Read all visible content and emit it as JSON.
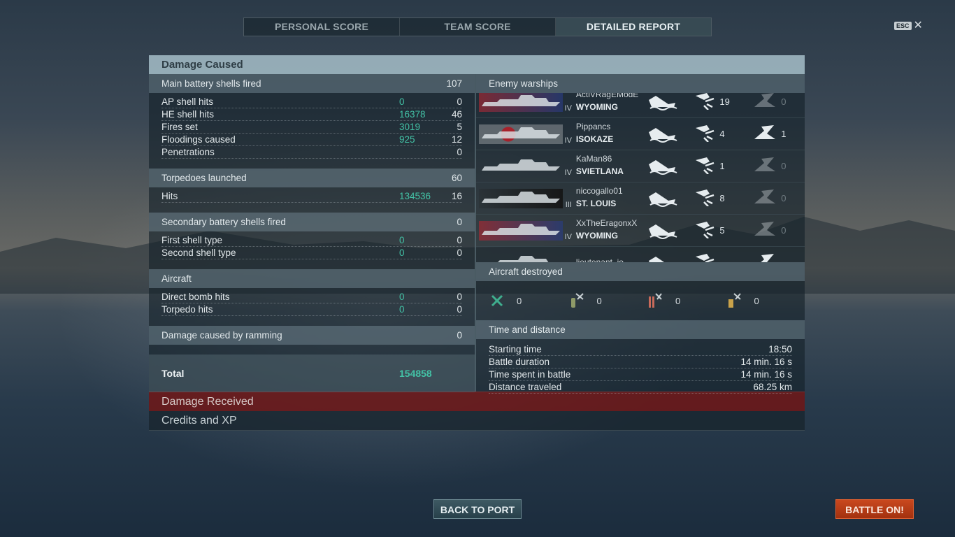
{
  "tabs": [
    "PERSONAL SCORE",
    "TEAM SCORE",
    "DETAILED REPORT"
  ],
  "esc_label": "ESC",
  "damage_caused": {
    "title": "Damage Caused",
    "main_battery": {
      "label": "Main battery shells fired",
      "count": "107",
      "rows": [
        {
          "label": "AP shell hits",
          "damage": "0",
          "count": "0"
        },
        {
          "label": "HE shell hits",
          "damage": "16378",
          "count": "46"
        },
        {
          "label": "Fires set",
          "damage": "3019",
          "count": "5"
        },
        {
          "label": "Floodings caused",
          "damage": "925",
          "count": "12"
        },
        {
          "label": "Penetrations",
          "damage": "",
          "count": "0"
        }
      ]
    },
    "torpedoes": {
      "label": "Torpedoes launched",
      "count": "60",
      "rows": [
        {
          "label": "Hits",
          "damage": "134536",
          "count": "16"
        }
      ]
    },
    "secondary": {
      "label": "Secondary battery shells fired",
      "count": "0",
      "rows": [
        {
          "label": "First shell type",
          "damage": "0",
          "count": "0"
        },
        {
          "label": "Second shell type",
          "damage": "0",
          "count": "0"
        }
      ]
    },
    "aircraft": {
      "label": "Aircraft",
      "rows": [
        {
          "label": "Direct bomb hits",
          "damage": "0",
          "count": "0"
        },
        {
          "label": "Torpedo hits",
          "damage": "0",
          "count": "0"
        }
      ]
    },
    "ramming": {
      "label": "Damage caused by ramming",
      "count": "0"
    },
    "total": {
      "label": "Total",
      "value": "154858"
    }
  },
  "enemy_warships": {
    "title": "Enemy warships",
    "ships": [
      {
        "player": "ActiVRagEModE",
        "tier": "IV",
        "ship": "WYOMING",
        "hits": "19",
        "sunk": "0",
        "flag": "usa"
      },
      {
        "player": "Pippancs",
        "tier": "IV",
        "ship": "ISOKAZE",
        "hits": "4",
        "sunk": "1",
        "flag": "japan"
      },
      {
        "player": "KaMan86",
        "tier": "IV",
        "ship": "SVIETLANA",
        "hits": "1",
        "sunk": "0",
        "flag": "none"
      },
      {
        "player": "niccogallo01",
        "tier": "III",
        "ship": "ST. LOUIS",
        "hits": "8",
        "sunk": "0",
        "flag": "dark"
      },
      {
        "player": "XxTheEragonxX",
        "tier": "IV",
        "ship": "WYOMING",
        "hits": "5",
        "sunk": "0",
        "flag": "usa"
      },
      {
        "player": "lieutenant_io",
        "tier": "",
        "ship": "",
        "hits": "",
        "sunk": "",
        "flag": "none"
      }
    ]
  },
  "aircraft_destroyed": {
    "title": "Aircraft destroyed",
    "items": [
      {
        "icon": "fighter-icon",
        "value": "0"
      },
      {
        "icon": "torpedo-bomber-icon",
        "value": "0"
      },
      {
        "icon": "dive-bomber-icon",
        "value": "0"
      },
      {
        "icon": "spotter-icon",
        "value": "0"
      }
    ]
  },
  "time_distance": {
    "title": "Time and distance",
    "rows": [
      {
        "label": "Starting time",
        "value": "18:50"
      },
      {
        "label": "Battle duration",
        "value": "14 min. 16 s"
      },
      {
        "label": "Time spent in battle",
        "value": "14 min. 16 s"
      },
      {
        "label": "Distance traveled",
        "value": "68.25 km"
      }
    ]
  },
  "damage_received": "Damage Received",
  "credits_xp": "Credits and XP",
  "buttons": {
    "back": "BACK TO PORT",
    "battle": "BATTLE ON!"
  },
  "colors": {
    "damage_value": "#43c2a6",
    "received_bar": "#6e1616",
    "battle_button": "#c9481e"
  }
}
